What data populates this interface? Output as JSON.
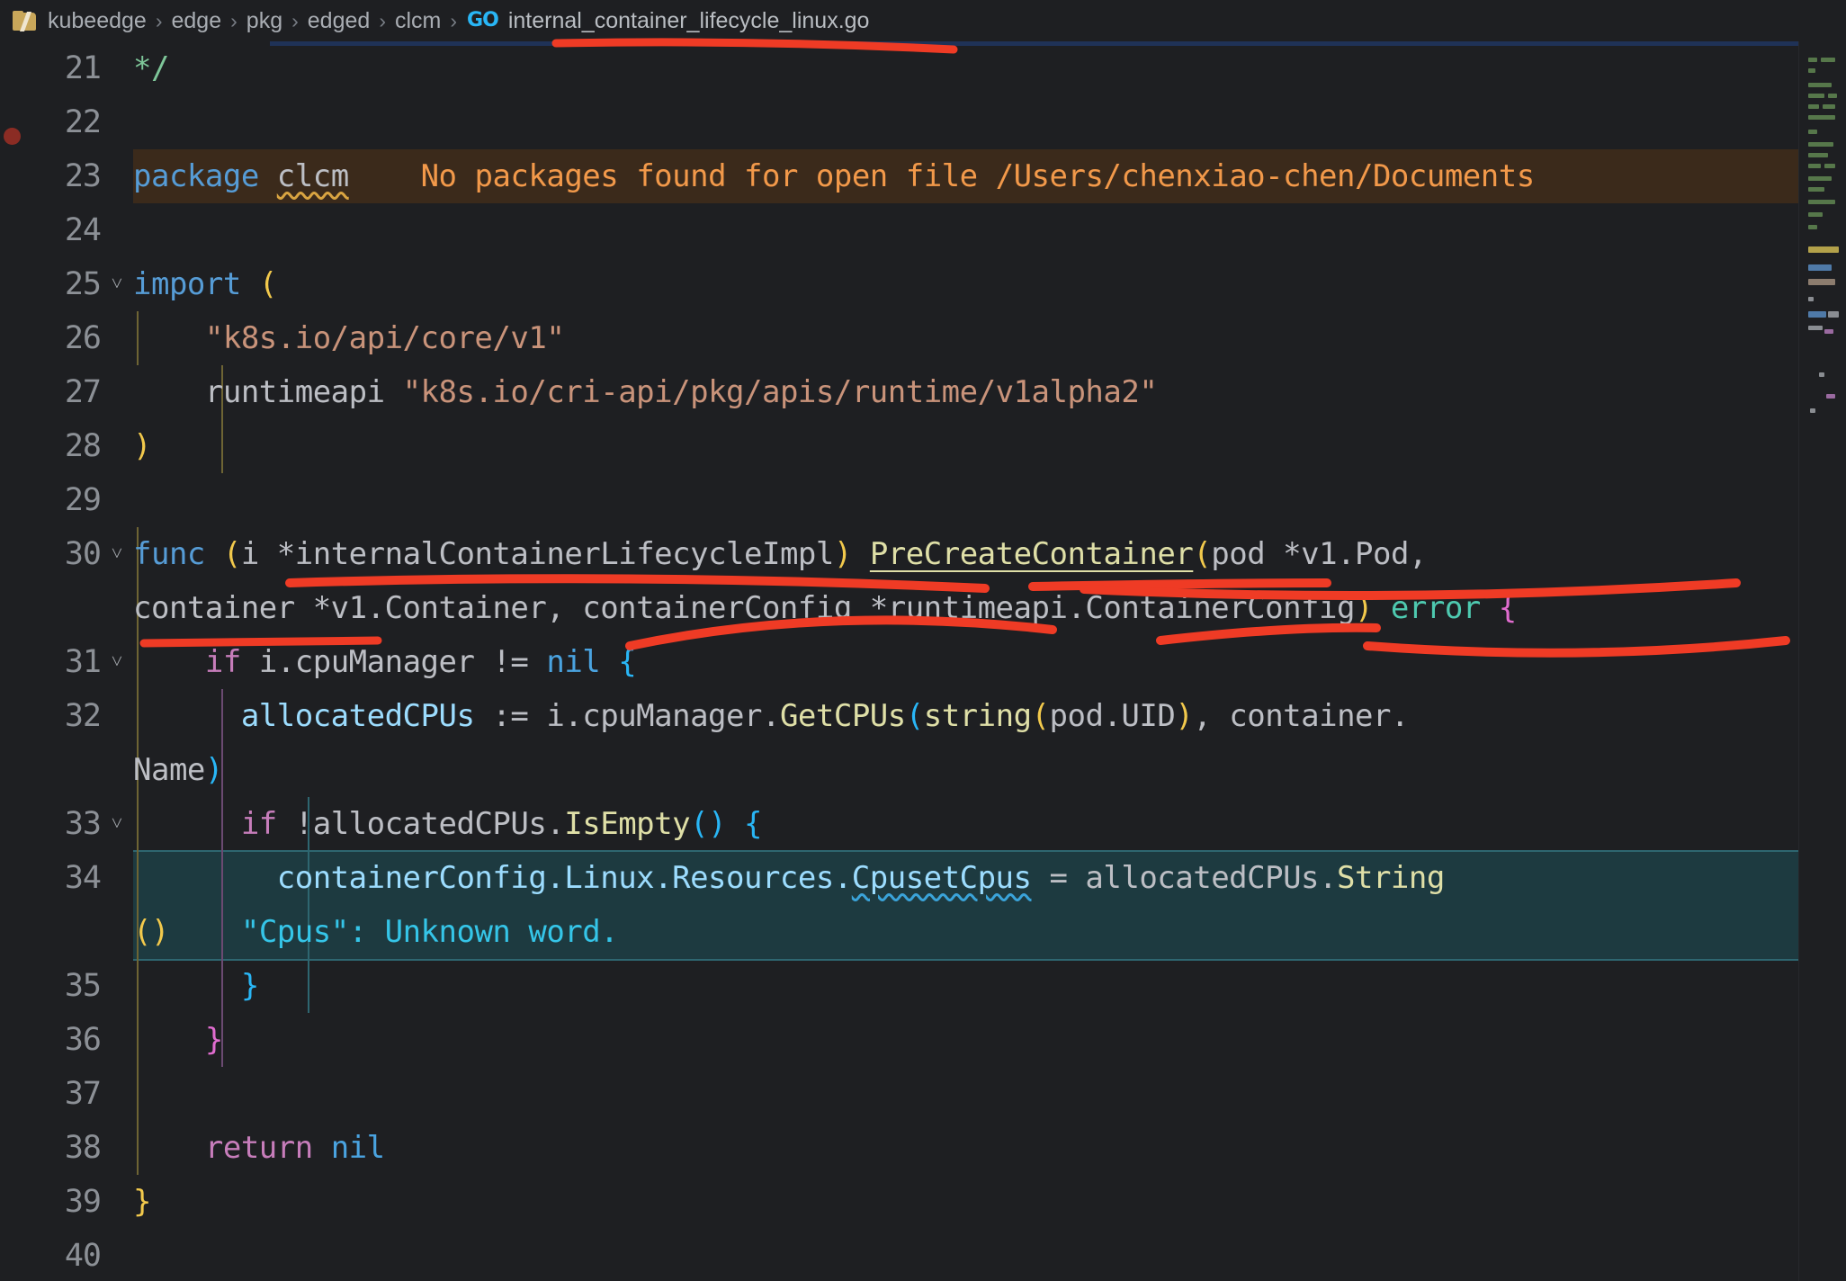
{
  "breadcrumb": {
    "folder_icon": "folder-icon",
    "items": [
      "kubeedge",
      "edge",
      "pkg",
      "edged",
      "clcm"
    ],
    "separator": "›",
    "go_icon_label": "GO",
    "file": "internal_container_lifecycle_linux.go"
  },
  "editor": {
    "language": "go",
    "lines": [
      {
        "num": "21",
        "fold": "",
        "text": "*/"
      },
      {
        "num": "22",
        "fold": "",
        "text": ""
      },
      {
        "num": "23",
        "fold": "",
        "text": "package clcm"
      },
      {
        "num": "24",
        "fold": "",
        "text": ""
      },
      {
        "num": "25",
        "fold": "˅",
        "text": "import ("
      },
      {
        "num": "26",
        "fold": "",
        "text": "    \"k8s.io/api/core/v1\""
      },
      {
        "num": "27",
        "fold": "",
        "text": "    runtimeapi \"k8s.io/cri-api/pkg/apis/runtime/v1alpha2\""
      },
      {
        "num": "28",
        "fold": "",
        "text": ")"
      },
      {
        "num": "29",
        "fold": "",
        "text": ""
      },
      {
        "num": "30",
        "fold": "˅",
        "text": "func (i *internalContainerLifecycleImpl) PreCreateContainer(pod *v1.Pod, container *v1.Container, containerConfig *runtimeapi.ContainerConfig) error {"
      },
      {
        "num": "31",
        "fold": "˅",
        "text": "    if i.cpuManager != nil {"
      },
      {
        "num": "32",
        "fold": "",
        "text": "        allocatedCPUs := i.cpuManager.GetCPUs(string(pod.UID), container.Name)"
      },
      {
        "num": "33",
        "fold": "˅",
        "text": "        if !allocatedCPUs.IsEmpty() {"
      },
      {
        "num": "34",
        "fold": "",
        "text": "            containerConfig.Linux.Resources.CpusetCpus = allocatedCPUs.String()"
      },
      {
        "num": "35",
        "fold": "",
        "text": "        }"
      },
      {
        "num": "36",
        "fold": "",
        "text": "    }"
      },
      {
        "num": "37",
        "fold": "",
        "text": ""
      },
      {
        "num": "38",
        "fold": "",
        "text": "    return nil"
      },
      {
        "num": "39",
        "fold": "",
        "text": "}"
      },
      {
        "num": "40",
        "fold": "",
        "text": ""
      }
    ],
    "tokens": {
      "l21_comment": "*/",
      "l23_kw": "package",
      "l23_name": "clcm",
      "l25_kw": "import",
      "l25_paren": "(",
      "l26_str": "\"k8s.io/api/core/v1\"",
      "l27_alias": "runtimeapi",
      "l27_str": "\"k8s.io/cri-api/pkg/apis/runtime/v1alpha2\"",
      "l28_paren": ")",
      "l30_kw": "func",
      "l30_open": "(",
      "l30_recv": "i *internalContainerLifecycleImpl",
      "l30_close": ")",
      "l30_fn": "PreCreateContainer",
      "l30_paren2": "(",
      "l30_args": "pod *v1.Pod,",
      "l30b_args": "container *v1.Container, containerConfig *runtimeapi.ContainerConfig",
      "l30b_close": ")",
      "l30b_ret": "error",
      "l30b_brace": "{",
      "l31_if": "if",
      "l31_expr": "i.cpuManager != ",
      "l31_nil": "nil",
      "l31_brace": "{",
      "l32_var": "allocatedCPUs",
      "l32_assign": " := ",
      "l32_recv": "i.cpuManager.",
      "l32_call": "GetCPUs",
      "l32_p1": "(",
      "l32_str": "string",
      "l32_p2": "(",
      "l32_arg": "pod.UID",
      "l32_p2c": ")",
      "l32_tail": ", container.",
      "l32b_tail": "Name",
      "l32b_close": ")",
      "l33_if": "if",
      "l33_bang": " !allocatedCPUs.",
      "l33_call": "IsEmpty",
      "l33_parens": "()",
      "l33_brace": " {",
      "l34_lhs": "containerConfig.Linux.Resources.",
      "l34_field": "CpusetCpus",
      "l34_eq": " = ",
      "l34_rhs": "allocatedCPUs.",
      "l34_fn": "String",
      "l34b_parens": "()",
      "l35_brace": "}",
      "l36_brace": "}",
      "l38_return": "return",
      "l38_nil": "nil",
      "l39_brace": "}"
    },
    "inline_messages": {
      "line23_error": "No packages found for open file /Users/chenxiao-chen/Documents",
      "line34_hint": "\"Cpus\": Unknown word."
    }
  },
  "annotations": {
    "color": "#ef3b25",
    "marks": [
      "underline-breadcrumb-filename",
      "underline-receiver-internalContainerLifecycleImpl",
      "underline-PreCreateContainer",
      "underline-containerConfig-param",
      "underline-runtimeapi-ContainerConfig",
      "underline-error-return"
    ]
  },
  "colors": {
    "background": "#1e1f22",
    "gutter_text": "#8c9096",
    "keyword": "#cf8e6d",
    "string": "#c9937a",
    "function": "#dfdfa7",
    "field": "#9cdcfe",
    "type_teal": "#4ec9b0",
    "error_band": "#3b2a1b",
    "error_text": "#f2994a",
    "selection_band": "#1d3a40",
    "hint_text": "#35c5e8",
    "annotation_red": "#ef3b25",
    "breakpoint": "#8b2c24"
  }
}
